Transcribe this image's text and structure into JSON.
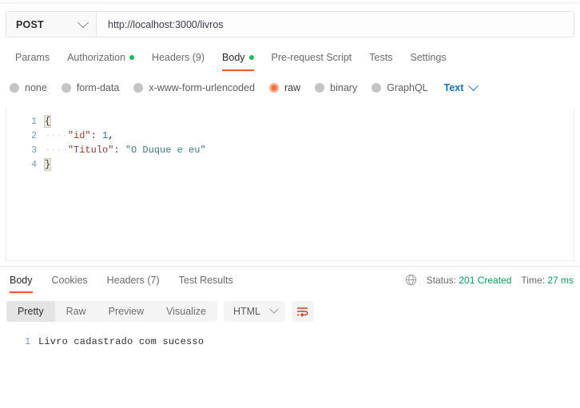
{
  "request": {
    "method": "POST",
    "url": "http://localhost:3000/livros",
    "tabs": [
      {
        "label": "Params",
        "dot": false,
        "active": false
      },
      {
        "label": "Authorization",
        "dot": true,
        "active": false
      },
      {
        "label": "Headers (9)",
        "dot": false,
        "active": false
      },
      {
        "label": "Body",
        "dot": true,
        "active": true
      },
      {
        "label": "Pre-request Script",
        "dot": false,
        "active": false
      },
      {
        "label": "Tests",
        "dot": false,
        "active": false
      },
      {
        "label": "Settings",
        "dot": false,
        "active": false
      }
    ],
    "body_types": [
      {
        "label": "none",
        "selected": false
      },
      {
        "label": "form-data",
        "selected": false
      },
      {
        "label": "x-www-form-urlencoded",
        "selected": false
      },
      {
        "label": "raw",
        "selected": true
      },
      {
        "label": "binary",
        "selected": false
      },
      {
        "label": "GraphQL",
        "selected": false
      }
    ],
    "raw_format": "Text",
    "body_editor": {
      "lines": [
        {
          "num": "1",
          "open_brace": "{"
        },
        {
          "num": "2",
          "indent": "····",
          "key": "\"id\"",
          "colon": ": ",
          "value": "1",
          "value_kind": "number",
          "trail": ","
        },
        {
          "num": "3",
          "indent": "····",
          "key": "\"Titulo\"",
          "colon": ": ",
          "value": "\"O Duque e eu\"",
          "value_kind": "string",
          "trail": ""
        },
        {
          "num": "4",
          "close_brace": "}"
        }
      ]
    }
  },
  "response": {
    "tabs": [
      {
        "label": "Body",
        "active": true
      },
      {
        "label": "Cookies",
        "active": false
      },
      {
        "label": "Headers (7)",
        "active": false
      },
      {
        "label": "Test Results",
        "active": false
      }
    ],
    "status_label": "Status:",
    "status_value": "201 Created",
    "time_label": "Time:",
    "time_value": "27 ms",
    "view_modes": [
      {
        "label": "Pretty",
        "active": true
      },
      {
        "label": "Raw",
        "active": false
      },
      {
        "label": "Preview",
        "active": false
      },
      {
        "label": "Visualize",
        "active": false
      }
    ],
    "format": "HTML",
    "body_lines": [
      {
        "num": "1",
        "text": "Livro cadastrado com sucesso"
      }
    ]
  },
  "colors": {
    "accent": "#ef5b25",
    "raw_selected": "#ff6c37",
    "success": "#0a9a5c",
    "dot_green": "#1db954",
    "link_blue": "#1573b5"
  }
}
